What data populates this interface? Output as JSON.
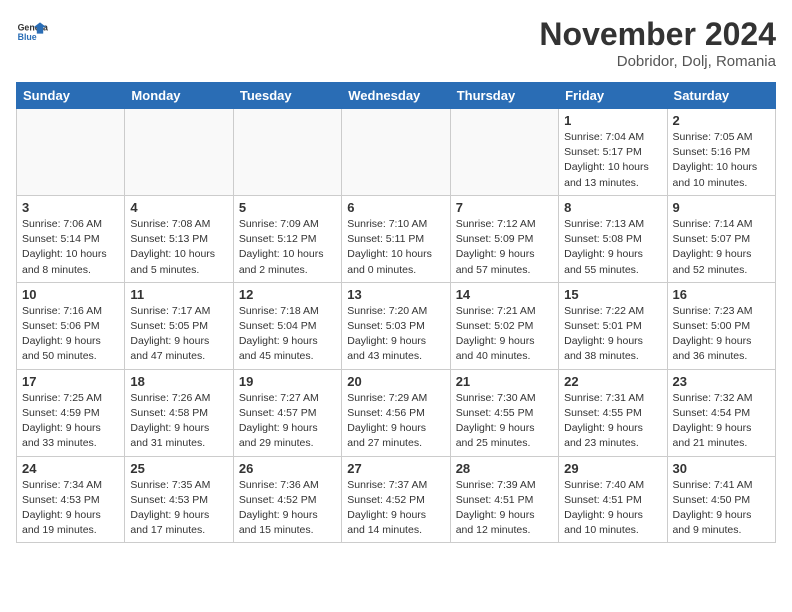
{
  "header": {
    "logo_line1": "General",
    "logo_line2": "Blue",
    "month": "November 2024",
    "location": "Dobridor, Dolj, Romania"
  },
  "weekdays": [
    "Sunday",
    "Monday",
    "Tuesday",
    "Wednesday",
    "Thursday",
    "Friday",
    "Saturday"
  ],
  "weeks": [
    [
      {
        "day": "",
        "info": ""
      },
      {
        "day": "",
        "info": ""
      },
      {
        "day": "",
        "info": ""
      },
      {
        "day": "",
        "info": ""
      },
      {
        "day": "",
        "info": ""
      },
      {
        "day": "1",
        "info": "Sunrise: 7:04 AM\nSunset: 5:17 PM\nDaylight: 10 hours and 13 minutes."
      },
      {
        "day": "2",
        "info": "Sunrise: 7:05 AM\nSunset: 5:16 PM\nDaylight: 10 hours and 10 minutes."
      }
    ],
    [
      {
        "day": "3",
        "info": "Sunrise: 7:06 AM\nSunset: 5:14 PM\nDaylight: 10 hours and 8 minutes."
      },
      {
        "day": "4",
        "info": "Sunrise: 7:08 AM\nSunset: 5:13 PM\nDaylight: 10 hours and 5 minutes."
      },
      {
        "day": "5",
        "info": "Sunrise: 7:09 AM\nSunset: 5:12 PM\nDaylight: 10 hours and 2 minutes."
      },
      {
        "day": "6",
        "info": "Sunrise: 7:10 AM\nSunset: 5:11 PM\nDaylight: 10 hours and 0 minutes."
      },
      {
        "day": "7",
        "info": "Sunrise: 7:12 AM\nSunset: 5:09 PM\nDaylight: 9 hours and 57 minutes."
      },
      {
        "day": "8",
        "info": "Sunrise: 7:13 AM\nSunset: 5:08 PM\nDaylight: 9 hours and 55 minutes."
      },
      {
        "day": "9",
        "info": "Sunrise: 7:14 AM\nSunset: 5:07 PM\nDaylight: 9 hours and 52 minutes."
      }
    ],
    [
      {
        "day": "10",
        "info": "Sunrise: 7:16 AM\nSunset: 5:06 PM\nDaylight: 9 hours and 50 minutes."
      },
      {
        "day": "11",
        "info": "Sunrise: 7:17 AM\nSunset: 5:05 PM\nDaylight: 9 hours and 47 minutes."
      },
      {
        "day": "12",
        "info": "Sunrise: 7:18 AM\nSunset: 5:04 PM\nDaylight: 9 hours and 45 minutes."
      },
      {
        "day": "13",
        "info": "Sunrise: 7:20 AM\nSunset: 5:03 PM\nDaylight: 9 hours and 43 minutes."
      },
      {
        "day": "14",
        "info": "Sunrise: 7:21 AM\nSunset: 5:02 PM\nDaylight: 9 hours and 40 minutes."
      },
      {
        "day": "15",
        "info": "Sunrise: 7:22 AM\nSunset: 5:01 PM\nDaylight: 9 hours and 38 minutes."
      },
      {
        "day": "16",
        "info": "Sunrise: 7:23 AM\nSunset: 5:00 PM\nDaylight: 9 hours and 36 minutes."
      }
    ],
    [
      {
        "day": "17",
        "info": "Sunrise: 7:25 AM\nSunset: 4:59 PM\nDaylight: 9 hours and 33 minutes."
      },
      {
        "day": "18",
        "info": "Sunrise: 7:26 AM\nSunset: 4:58 PM\nDaylight: 9 hours and 31 minutes."
      },
      {
        "day": "19",
        "info": "Sunrise: 7:27 AM\nSunset: 4:57 PM\nDaylight: 9 hours and 29 minutes."
      },
      {
        "day": "20",
        "info": "Sunrise: 7:29 AM\nSunset: 4:56 PM\nDaylight: 9 hours and 27 minutes."
      },
      {
        "day": "21",
        "info": "Sunrise: 7:30 AM\nSunset: 4:55 PM\nDaylight: 9 hours and 25 minutes."
      },
      {
        "day": "22",
        "info": "Sunrise: 7:31 AM\nSunset: 4:55 PM\nDaylight: 9 hours and 23 minutes."
      },
      {
        "day": "23",
        "info": "Sunrise: 7:32 AM\nSunset: 4:54 PM\nDaylight: 9 hours and 21 minutes."
      }
    ],
    [
      {
        "day": "24",
        "info": "Sunrise: 7:34 AM\nSunset: 4:53 PM\nDaylight: 9 hours and 19 minutes."
      },
      {
        "day": "25",
        "info": "Sunrise: 7:35 AM\nSunset: 4:53 PM\nDaylight: 9 hours and 17 minutes."
      },
      {
        "day": "26",
        "info": "Sunrise: 7:36 AM\nSunset: 4:52 PM\nDaylight: 9 hours and 15 minutes."
      },
      {
        "day": "27",
        "info": "Sunrise: 7:37 AM\nSunset: 4:52 PM\nDaylight: 9 hours and 14 minutes."
      },
      {
        "day": "28",
        "info": "Sunrise: 7:39 AM\nSunset: 4:51 PM\nDaylight: 9 hours and 12 minutes."
      },
      {
        "day": "29",
        "info": "Sunrise: 7:40 AM\nSunset: 4:51 PM\nDaylight: 9 hours and 10 minutes."
      },
      {
        "day": "30",
        "info": "Sunrise: 7:41 AM\nSunset: 4:50 PM\nDaylight: 9 hours and 9 minutes."
      }
    ]
  ]
}
